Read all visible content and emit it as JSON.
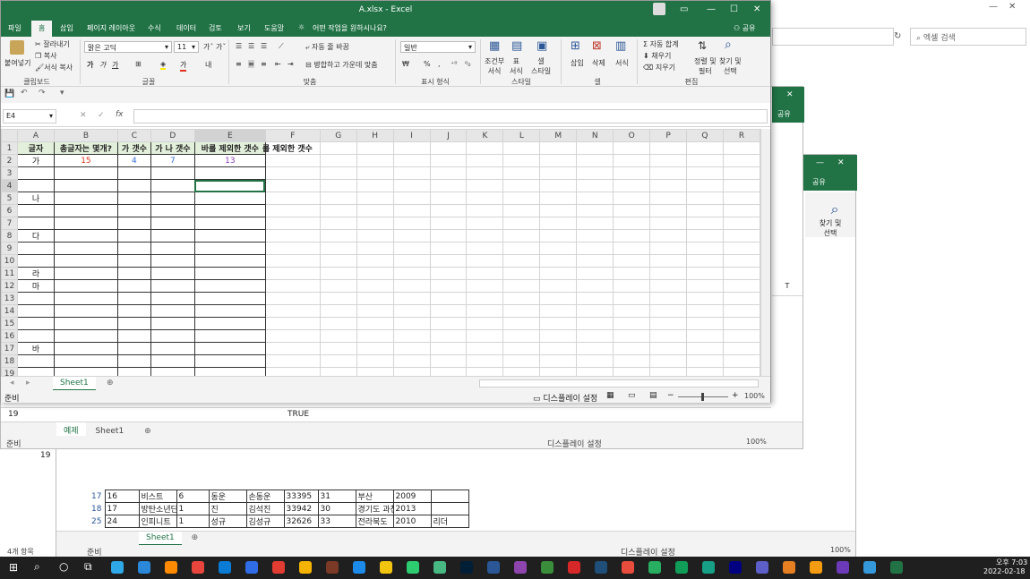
{
  "explorer": {
    "search_placeholder": "엑셀 검색",
    "status": "4개 항목"
  },
  "win2": {
    "share": "공유",
    "find_label": "찾기 및\n선택",
    "col_t": "T",
    "rows": [
      {
        "num": "19",
        "val": "TRUE"
      }
    ],
    "tabs": [
      "예제",
      "Sheet1"
    ],
    "status_ready": "준비",
    "display_settings": "디스플레이 설정",
    "zoom": "100%"
  },
  "win3": {
    "share": "공유",
    "find_label": "찾기 및\n선택",
    "row_19": "19",
    "rows": [
      {
        "num": "17",
        "cells": [
          "16",
          "비스트",
          "6",
          "동운",
          "손동운",
          "33395",
          "31",
          "부산",
          "2009",
          ""
        ]
      },
      {
        "num": "18",
        "cells": [
          "17",
          "방탄소년단",
          "1",
          "진",
          "김석진",
          "33942",
          "30",
          "경기도 과천",
          "2013",
          ""
        ]
      },
      {
        "num": "25",
        "cells": [
          "24",
          "인피니트",
          "1",
          "성규",
          "김성규",
          "32626",
          "33",
          "전라북도",
          "2010",
          "리더"
        ]
      }
    ],
    "tab": "Sheet1",
    "status_ready": "준비",
    "display_settings": "디스플레이 설정",
    "zoom": "100%"
  },
  "main": {
    "title": "A.xlsx  -  Excel",
    "menu": [
      "파일",
      "홈",
      "삽입",
      "페이지 레이아웃",
      "수식",
      "데이터",
      "검토",
      "보기",
      "도움말"
    ],
    "tell_me": "어떤 작업을 원하시나요?",
    "share": "공유",
    "ribbon": {
      "paste": "붙여넣기",
      "cut": "잘라내기",
      "copy": "복사",
      "format_painter": "서식 복사",
      "group_clipboard": "클립보드",
      "font_name": "맑은 고딕",
      "font_size": "11",
      "group_font": "글꼴",
      "wrap": "자동 줄 바꿈",
      "merge": "병합하고 가운데 맞춤",
      "group_align": "맞춤",
      "number_format": "일반",
      "group_number": "표시 형식",
      "cond_format": "조건부\n서식",
      "table_format": "표\n서식",
      "cell_style": "셀\n스타일",
      "group_style": "스타일",
      "insert": "삽입",
      "delete": "삭제",
      "format": "서식",
      "group_cells": "셀",
      "autosum": "자동 합계",
      "fill": "채우기",
      "clear": "지우기",
      "sort": "정렬 및\n필터",
      "find": "찾기 및\n선택",
      "group_edit": "편집"
    },
    "name_box": "E4",
    "columns": [
      "A",
      "B",
      "C",
      "D",
      "E",
      "F",
      "G",
      "H",
      "I",
      "J",
      "K",
      "L",
      "M",
      "N",
      "O",
      "P",
      "Q",
      "R"
    ],
    "rows": [
      {
        "n": "1",
        "A": "글자",
        "B": "총글자는 몇개?",
        "C": "가 갯수",
        "D": "가 나 갯수",
        "E": "바를 제외한 갯수",
        "F": "를 제외한 갯수"
      },
      {
        "n": "2",
        "A": "가",
        "B": "15",
        "C": "4",
        "D": "7",
        "E": "13"
      },
      {
        "n": "3"
      },
      {
        "n": "4"
      },
      {
        "n": "5",
        "A": "나"
      },
      {
        "n": "6"
      },
      {
        "n": "7"
      },
      {
        "n": "8",
        "A": "다"
      },
      {
        "n": "9"
      },
      {
        "n": "10"
      },
      {
        "n": "11",
        "A": "라"
      },
      {
        "n": "12",
        "A": "마"
      },
      {
        "n": "13"
      },
      {
        "n": "14"
      },
      {
        "n": "15"
      },
      {
        "n": "16"
      },
      {
        "n": "17",
        "A": "바"
      },
      {
        "n": "18"
      },
      {
        "n": "19"
      }
    ],
    "tab": "Sheet1",
    "status_ready": "준비",
    "display_settings": "디스플레이 설정",
    "zoom": "100%"
  },
  "colors": {
    "excel_green": "#217346",
    "red_value": "#e0301e",
    "blue_value": "#3a6fd8",
    "purple_value": "#8a3ab9",
    "header_fill": "#e2efda"
  },
  "taskbar": {
    "time": "오후 7:03",
    "date": "2022-02-18"
  }
}
